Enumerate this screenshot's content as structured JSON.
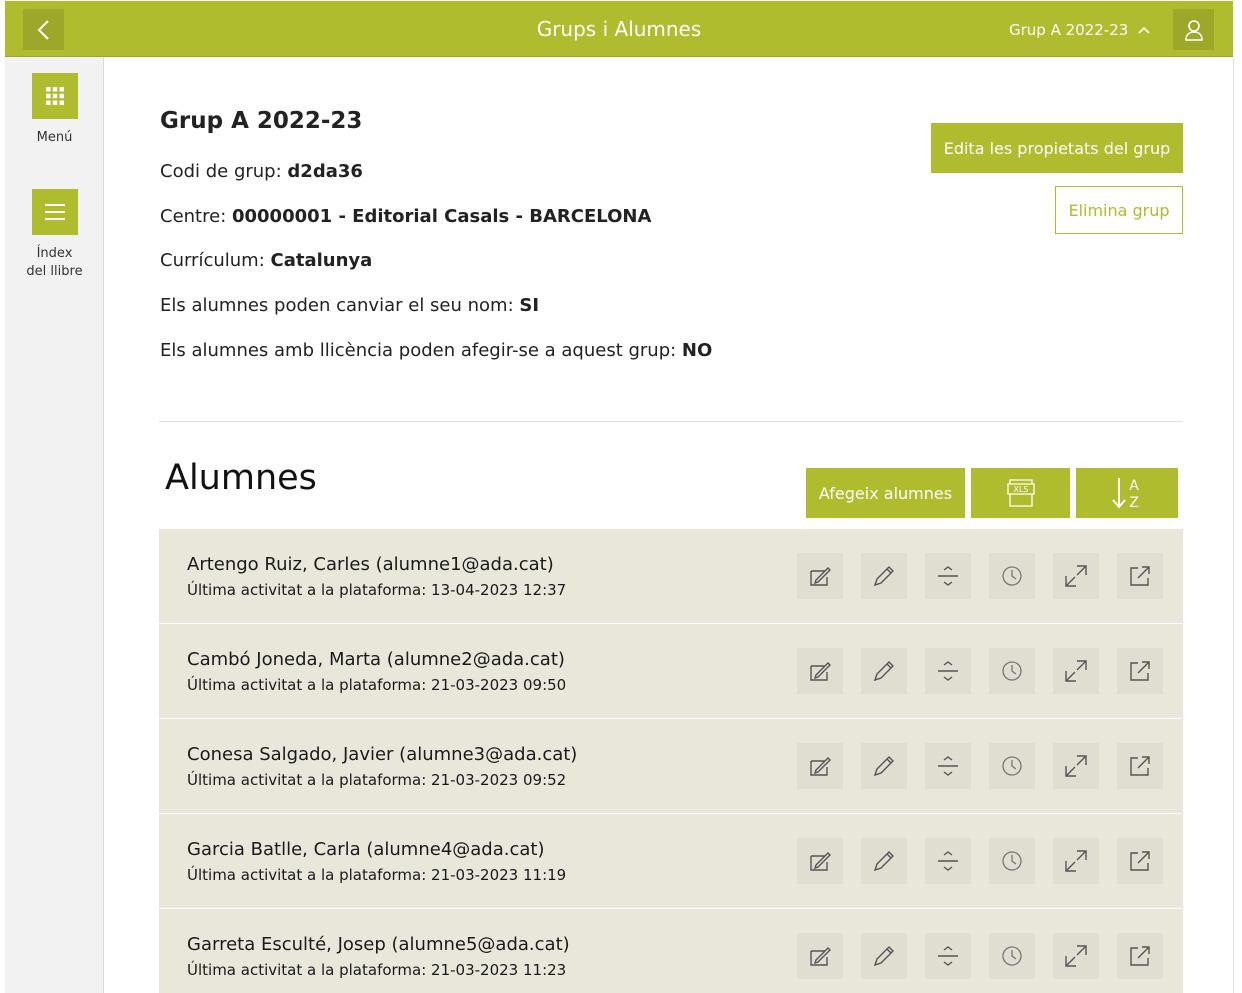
{
  "header": {
    "title": "Grups i Alumnes",
    "group_selector": "Grup A 2022-23",
    "back_icon": "chevron-left-icon",
    "user_icon": "user-icon"
  },
  "sidebar": {
    "items": [
      {
        "label": "Menú",
        "icon": "grid-icon"
      },
      {
        "label_line1": "Índex",
        "label_line2": "del llibre",
        "icon": "list-icon"
      }
    ]
  },
  "group": {
    "title": "Grup A 2022-23",
    "code_label": "Codi de grup: ",
    "code_value": "d2da36",
    "centre_label": "Centre: ",
    "centre_value": "00000001 - Editorial Casals - BARCELONA",
    "curriculum_label": "Currículum: ",
    "curriculum_value": "Catalunya",
    "rename_label": "Els alumnes poden canviar el seu nom: ",
    "rename_value": "SI",
    "join_label": "Els alumnes amb llicència poden afegir-se a aquest grup: ",
    "join_value": "NO",
    "edit_button": "Edita les propietats del grup",
    "delete_button": "Elimina grup"
  },
  "students_section": {
    "title": "Alumnes",
    "add_button": "Afegeix alumnes",
    "xls_label": "XLS",
    "sort_label_top": "A",
    "sort_label_bottom": "Z"
  },
  "students": [
    {
      "name": "Artengo Ruiz, Carles (alumne1@ada.cat)",
      "activity": "Última activitat a la plataforma: 13-04-2023 12:37"
    },
    {
      "name": "Cambó Joneda, Marta (alumne2@ada.cat)",
      "activity": "Última activitat a la plataforma: 21-03-2023 09:50"
    },
    {
      "name": "Conesa Salgado, Javier (alumne3@ada.cat)",
      "activity": "Última activitat a la plataforma: 21-03-2023 09:52"
    },
    {
      "name": "Garcia Batlle, Carla (alumne4@ada.cat)",
      "activity": "Última activitat a la plataforma: 21-03-2023 11:19"
    },
    {
      "name": "Garreta Esculté, Josep (alumne5@ada.cat)",
      "activity": "Última activitat a la plataforma: 21-03-2023 11:23"
    }
  ],
  "colors": {
    "accent": "#afbc2d",
    "row_background": "#e8e7da",
    "action_background": "#dfded1"
  }
}
